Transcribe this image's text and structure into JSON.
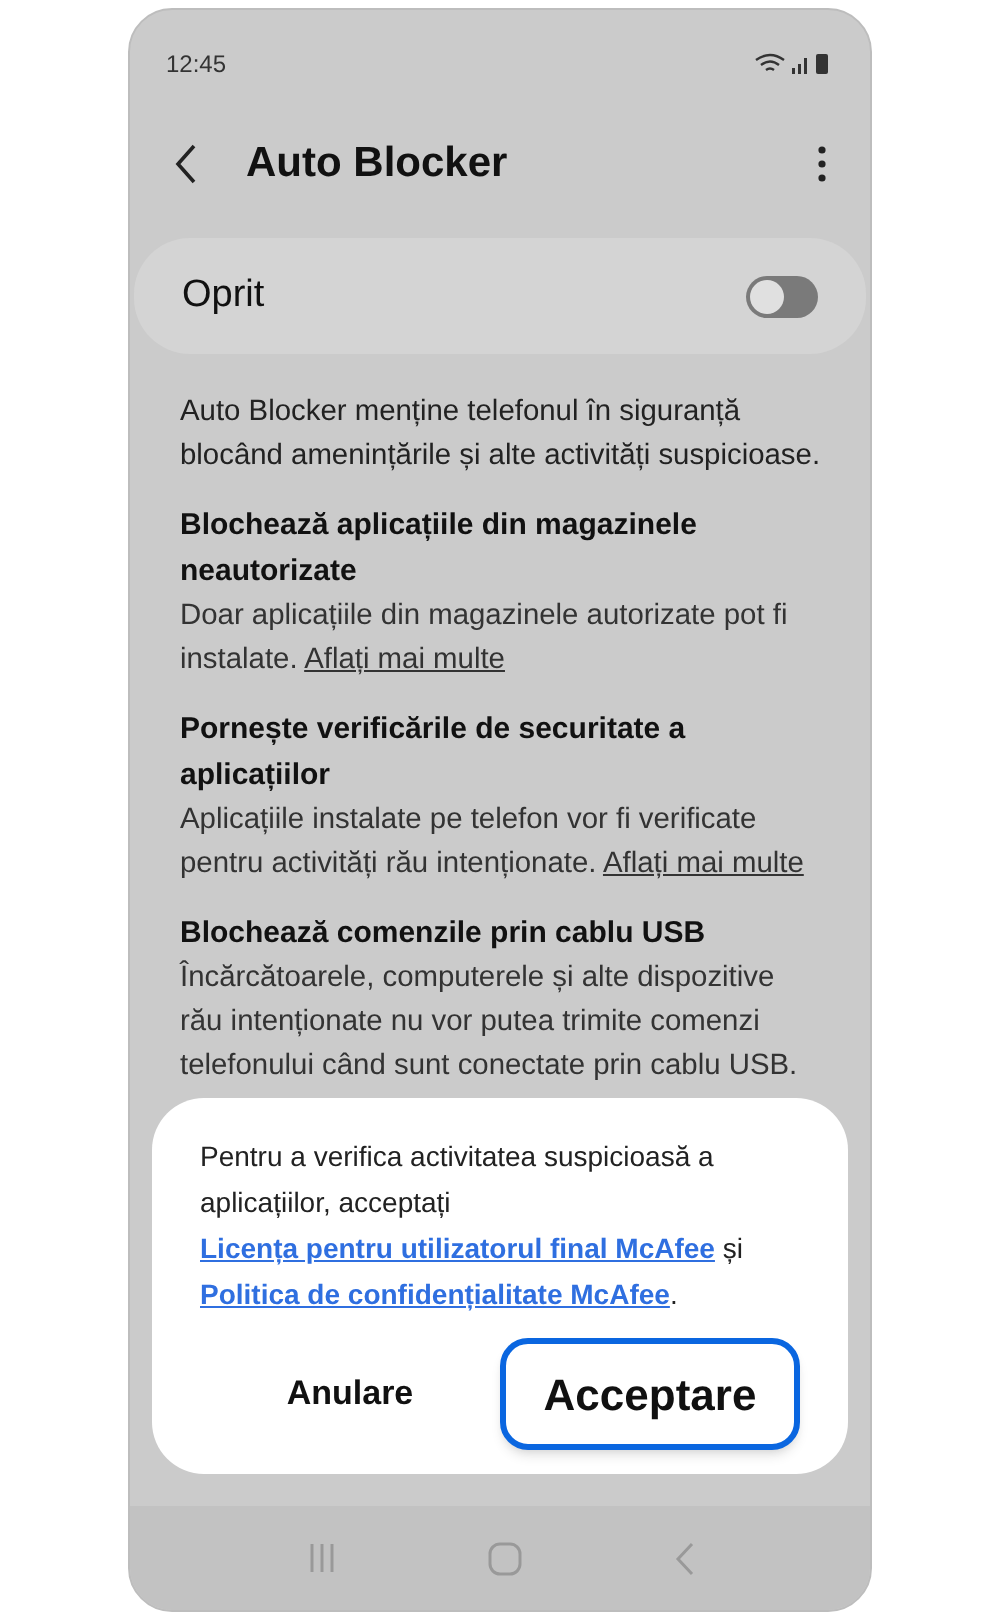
{
  "status_bar": {
    "time": "12:45"
  },
  "header": {
    "title": "Auto Blocker"
  },
  "master_switch": {
    "label": "Oprit",
    "on": false
  },
  "description": "Auto Blocker menține telefonul în siguranță blocând amenințările și alte activități suspicioase.",
  "sections": [
    {
      "title": "Blochează aplicațiile din magazinele neautorizate",
      "body": "Doar aplicațiile din magazinele autorizate pot fi instalate.",
      "link": "Aflați mai multe"
    },
    {
      "title": "Pornește verificările de securitate a aplicațiilor",
      "body": "Aplicațiile instalate pe telefon vor fi verificate pentru activități rău intenționate.",
      "link": "Aflați mai multe"
    },
    {
      "title": "Blochează comenzile prin cablu USB",
      "body": "Încărcătoarele, computerele și alte dispozitive rău intenționate nu vor putea trimite comenzi telefonului când sunt conectate prin cablu USB."
    }
  ],
  "dialog": {
    "message": [
      {
        "kind": "text",
        "text": "Pentru a verifica activitatea suspicioasă a aplicațiilor, acceptați"
      },
      {
        "kind": "link",
        "text": "Licența pentru utilizatorul final McAfee"
      },
      {
        "kind": "text",
        "text": "și"
      },
      {
        "kind": "link",
        "text": "Politica de confidențialitate McAfee"
      },
      {
        "kind": "text",
        "text": "."
      }
    ],
    "buttons": [
      {
        "label": "Anulare",
        "selected": false
      },
      {
        "label": "Acceptare",
        "selected": true
      }
    ]
  }
}
